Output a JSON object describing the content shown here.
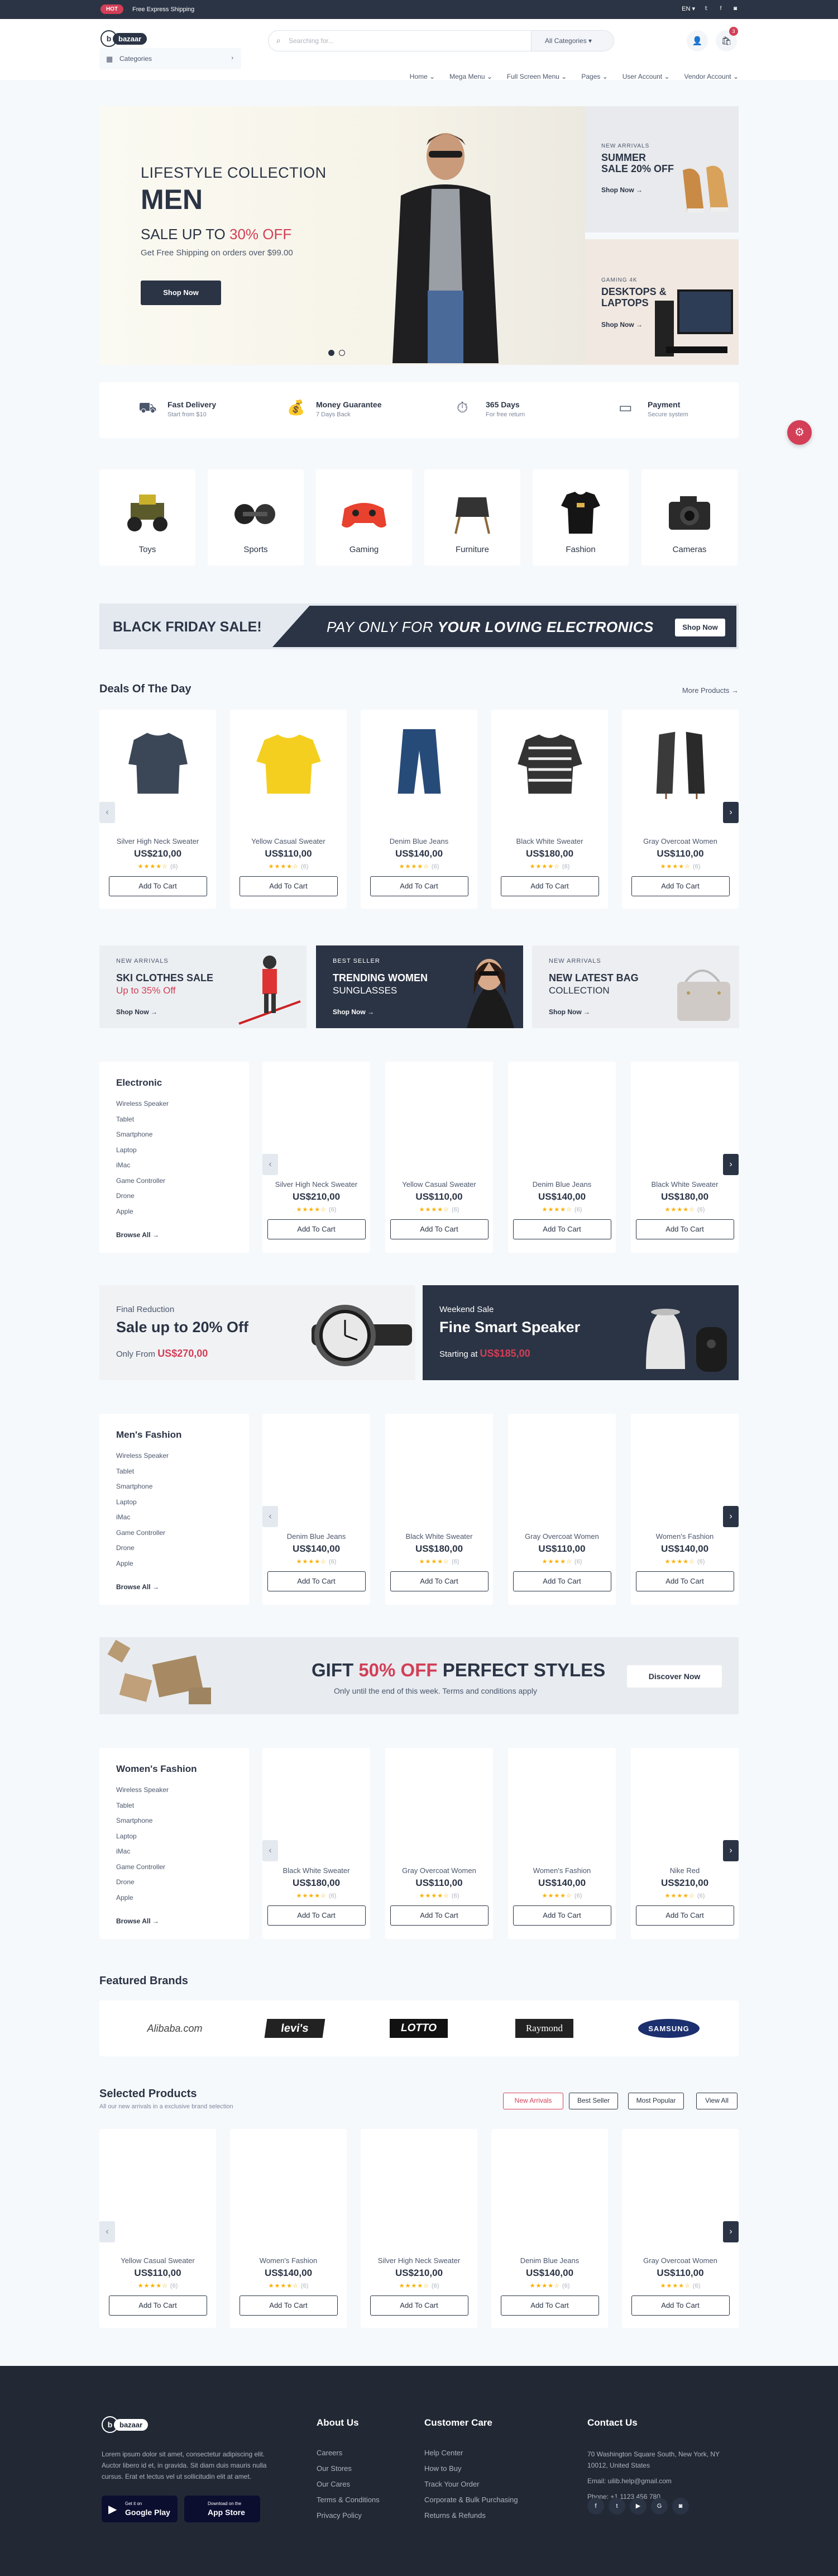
{
  "topbar": {
    "badge": "HOT",
    "shipping": "Free Express Shipping",
    "lang": "EN"
  },
  "header": {
    "logo": "bazaar",
    "search_placeholder": "Searching for...",
    "category_select": "All Categories",
    "cart_count": "3",
    "categories_button": "Categories",
    "nav": [
      "Home",
      "Mega Menu",
      "Full Screen Menu",
      "Pages",
      "User Account",
      "Vendor Account"
    ]
  },
  "hero": {
    "kicker": "LIFESTYLE COLLECTION",
    "title": "MEN",
    "sale_prefix": "SALE UP TO ",
    "sale_accent": "30% OFF",
    "free": "Get Free Shipping on orders over $99.00",
    "button": "Shop Now"
  },
  "side_promos": [
    {
      "kicker": "NEW ARRIVALS",
      "title_1": "SUMMER",
      "title_2": "SALE 20% OFF",
      "link": "Shop Now"
    },
    {
      "kicker": "GAMING 4K",
      "title_1": "DESKTOPS &",
      "title_2": "LAPTOPS",
      "link": "Shop Now"
    }
  ],
  "services": [
    {
      "title": "Fast Delivery",
      "subtitle": "Start from $10",
      "icon": "truck-icon"
    },
    {
      "title": "Money Guarantee",
      "subtitle": "7 Days Back",
      "icon": "money-bag-icon"
    },
    {
      "title": "365 Days",
      "subtitle": "For free return",
      "icon": "clock-icon"
    },
    {
      "title": "Payment",
      "subtitle": "Secure system",
      "icon": "wallet-icon"
    }
  ],
  "categories": [
    "Toys",
    "Sports",
    "Gaming",
    "Furniture",
    "Fashion",
    "Cameras"
  ],
  "black_friday": {
    "left": "BLACK FRIDAY SALE!",
    "middle_1": "PAY ONLY FOR ",
    "middle_2": "YOUR LOVING ELECTRONICS",
    "button": "Shop Now"
  },
  "deals": {
    "title": "Deals Of The Day",
    "more": "More Products",
    "products": [
      {
        "name": "Silver High Neck Sweater",
        "price": "US$210,00",
        "stars": "★★★★☆",
        "reviews": "(6)",
        "cta": "Add To Cart"
      },
      {
        "name": "Yellow Casual Sweater",
        "price": "US$110,00",
        "stars": "★★★★☆",
        "reviews": "(6)",
        "cta": "Add To Cart"
      },
      {
        "name": "Denim Blue Jeans",
        "price": "US$140,00",
        "stars": "★★★★☆",
        "reviews": "(6)",
        "cta": "Add To Cart"
      },
      {
        "name": "Black White Sweater",
        "price": "US$180,00",
        "stars": "★★★★☆",
        "reviews": "(6)",
        "cta": "Add To Cart"
      },
      {
        "name": "Gray Overcoat Women",
        "price": "US$110,00",
        "stars": "★★★★☆",
        "reviews": "(6)",
        "cta": "Add To Cart"
      }
    ]
  },
  "promo_trio": [
    {
      "kicker": "NEW ARRIVALS",
      "title_1": "SKI CLOTHES SALE",
      "title_2": "Up to 35% Off",
      "link": "Shop Now"
    },
    {
      "kicker": "BEST SELLER",
      "title_1": "TRENDING WOMEN",
      "title_2": "SUNGLASSES",
      "link": "Shop Now"
    },
    {
      "kicker": "NEW ARRIVALS",
      "title_1": "NEW LATEST BAG",
      "title_2": "COLLECTION",
      "link": "Shop Now"
    }
  ],
  "sidebar_items": [
    "Wireless Speaker",
    "Tablet",
    "Smartphone",
    "Laptop",
    "iMac",
    "Game Controller",
    "Drone",
    "Apple"
  ],
  "browse_all": "Browse All",
  "electronic": {
    "title": "Electronic",
    "products": [
      {
        "name": "Silver High Neck Sweater",
        "price": "US$210,00",
        "stars": "★★★★☆",
        "reviews": "(6)",
        "cta": "Add To Cart"
      },
      {
        "name": "Yellow Casual Sweater",
        "price": "US$110,00",
        "stars": "★★★★☆",
        "reviews": "(6)",
        "cta": "Add To Cart"
      },
      {
        "name": "Denim Blue Jeans",
        "price": "US$140,00",
        "stars": "★★★★☆",
        "reviews": "(6)",
        "cta": "Add To Cart"
      },
      {
        "name": "Black White Sweater",
        "price": "US$180,00",
        "stars": "★★★★☆",
        "reviews": "(6)",
        "cta": "Add To Cart"
      }
    ]
  },
  "wide_promos": [
    {
      "kicker": "Final Reduction",
      "title": "Sale up to 20% Off",
      "sub_prefix": "Only From ",
      "sub_price": "US$270,00"
    },
    {
      "kicker": "Weekend Sale",
      "title": "Fine Smart Speaker",
      "sub_prefix": "Starting at ",
      "sub_price": "US$185,00"
    }
  ],
  "mens": {
    "title": "Men's Fashion",
    "products": [
      {
        "name": "Denim Blue Jeans",
        "price": "US$140,00",
        "stars": "★★★★☆",
        "reviews": "(6)",
        "cta": "Add To Cart"
      },
      {
        "name": "Black White Sweater",
        "price": "US$180,00",
        "stars": "★★★★☆",
        "reviews": "(6)",
        "cta": "Add To Cart"
      },
      {
        "name": "Gray Overcoat Women",
        "price": "US$110,00",
        "stars": "★★★★☆",
        "reviews": "(6)",
        "cta": "Add To Cart"
      },
      {
        "name": "Women's Fashion",
        "price": "US$140,00",
        "stars": "★★★★☆",
        "reviews": "(6)",
        "cta": "Add To Cart"
      }
    ]
  },
  "gift": {
    "prefix": "GIFT ",
    "accent": "50% OFF",
    "suffix": " PERFECT STYLES",
    "sub": "Only until the end of this week. Terms and conditions apply",
    "button": "Discover Now"
  },
  "womens": {
    "title": "Women's Fashion",
    "products": [
      {
        "name": "Black White Sweater",
        "price": "US$180,00",
        "stars": "★★★★☆",
        "reviews": "(6)",
        "cta": "Add To Cart"
      },
      {
        "name": "Gray Overcoat Women",
        "price": "US$110,00",
        "stars": "★★★★☆",
        "reviews": "(6)",
        "cta": "Add To Cart"
      },
      {
        "name": "Women's Fashion",
        "price": "US$140,00",
        "stars": "★★★★☆",
        "reviews": "(6)",
        "cta": "Add To Cart"
      },
      {
        "name": "Nike Red",
        "price": "US$210,00",
        "stars": "★★★★☆",
        "reviews": "(6)",
        "cta": "Add To Cart"
      }
    ]
  },
  "brands": {
    "title": "Featured Brands",
    "logos": [
      "Alibaba.com",
      "levi's",
      "LOTTO",
      "Raymond",
      "SAMSUNG"
    ]
  },
  "selected": {
    "title": "Selected Products",
    "subtitle": "All our new arrivals in a exclusive brand selection",
    "tabs": [
      "New Arrivals",
      "Best Seller",
      "Most Popular",
      "View All"
    ],
    "products": [
      {
        "name": "Yellow Casual Sweater",
        "price": "US$110,00",
        "stars": "★★★★☆",
        "reviews": "(6)",
        "cta": "Add To Cart"
      },
      {
        "name": "Women's Fashion",
        "price": "US$140,00",
        "stars": "★★★★☆",
        "reviews": "(6)",
        "cta": "Add To Cart"
      },
      {
        "name": "Silver High Neck Sweater",
        "price": "US$210,00",
        "stars": "★★★★☆",
        "reviews": "(6)",
        "cta": "Add To Cart"
      },
      {
        "name": "Denim Blue Jeans",
        "price": "US$140,00",
        "stars": "★★★★☆",
        "reviews": "(6)",
        "cta": "Add To Cart"
      },
      {
        "name": "Gray Overcoat Women",
        "price": "US$110,00",
        "stars": "★★★★☆",
        "reviews": "(6)",
        "cta": "Add To Cart"
      }
    ]
  },
  "footer": {
    "logo": "bazaar",
    "about_text": [
      "Lorem ipsum dolor sit amet, consectetur adipiscing elit.",
      "Auctor libero id et, in gravida. Sit diam duis mauris nulla",
      "cursus. Erat et lectus vel ut sollicitudin elit at amet."
    ],
    "google_small": "Get it on",
    "google_big": "Google Play",
    "apple_small": "Download on the",
    "apple_big": "App Store",
    "about_title": "About Us",
    "about_links": [
      "Careers",
      "Our Stores",
      "Our Cares",
      "Terms & Conditions",
      "Privacy Policy"
    ],
    "care_title": "Customer Care",
    "care_links": [
      "Help Center",
      "How to Buy",
      "Track Your Order",
      "Corporate & Bulk Purchasing",
      "Returns & Refunds"
    ],
    "contact_title": "Contact Us",
    "contact_lines": [
      "70 Washington Square South, New York, NY",
      "10012, United States",
      "Email: uilib.help@gmail.com",
      "Phone: +1 1123 456 780"
    ]
  },
  "colors": {
    "accent": "#d23f57",
    "dark": "#2b3445",
    "bg": "#f6f9fc",
    "star": "#faaf00"
  }
}
